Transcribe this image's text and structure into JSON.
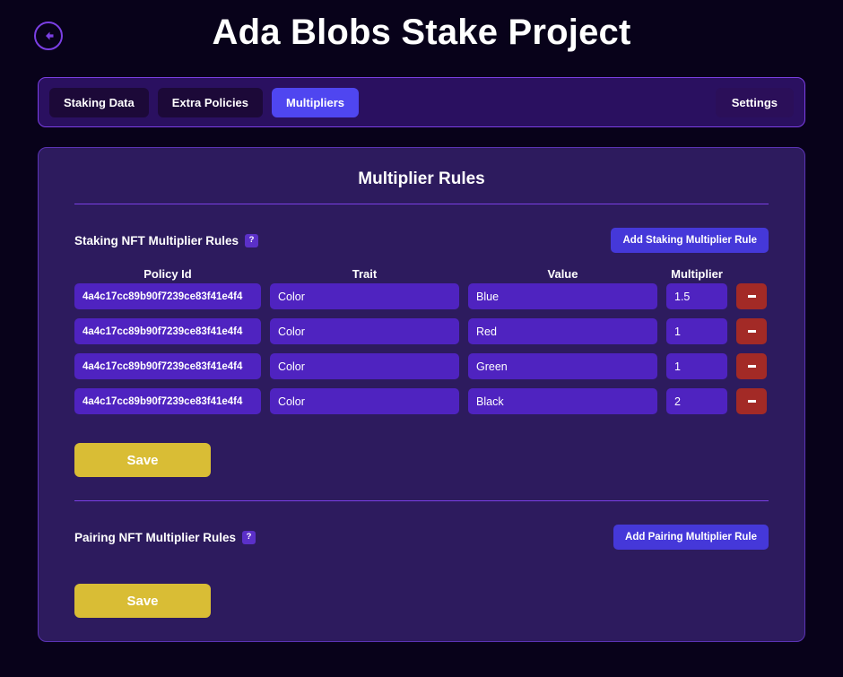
{
  "header": {
    "title": "Ada Blobs Stake Project",
    "back_icon": "arrow-left-circle-icon"
  },
  "nav": {
    "tabs": [
      {
        "label": "Staking Data",
        "active": false
      },
      {
        "label": "Extra Policies",
        "active": false
      },
      {
        "label": "Multipliers",
        "active": true
      }
    ],
    "settings_label": "Settings"
  },
  "card": {
    "title": "Multiplier Rules"
  },
  "staking_section": {
    "label": "Staking NFT Multiplier Rules",
    "help_glyph": "?",
    "add_button": "Add Staking Multiplier Rule",
    "columns": [
      "Policy Id",
      "Trait",
      "Value",
      "Multiplier"
    ],
    "rows": [
      {
        "policy_id": "4a4c17cc89b90f7239ce83f41e4f4",
        "trait": "Color",
        "value": "Blue",
        "multiplier": "1.5"
      },
      {
        "policy_id": "4a4c17cc89b90f7239ce83f41e4f4",
        "trait": "Color",
        "value": "Red",
        "multiplier": "1"
      },
      {
        "policy_id": "4a4c17cc89b90f7239ce83f41e4f4",
        "trait": "Color",
        "value": "Green",
        "multiplier": "1"
      },
      {
        "policy_id": "4a4c17cc89b90f7239ce83f41e4f4",
        "trait": "Color",
        "value": "Black",
        "multiplier": "2"
      }
    ],
    "save_label": "Save"
  },
  "pairing_section": {
    "label": "Pairing NFT Multiplier Rules",
    "help_glyph": "?",
    "add_button": "Add Pairing Multiplier Rule",
    "rows": [],
    "save_label": "Save"
  },
  "colors": {
    "page_bg": "#08021a",
    "card_bg": "#2d1b5e",
    "nav_bg": "#2a1060",
    "accent_blue": "#4538d9",
    "active_tab": "#4f46f0",
    "field_bg": "#4f23c0",
    "delete_red": "#a32a26",
    "save_gold": "#d9bd35",
    "border_purple": "#7b3fe4"
  }
}
